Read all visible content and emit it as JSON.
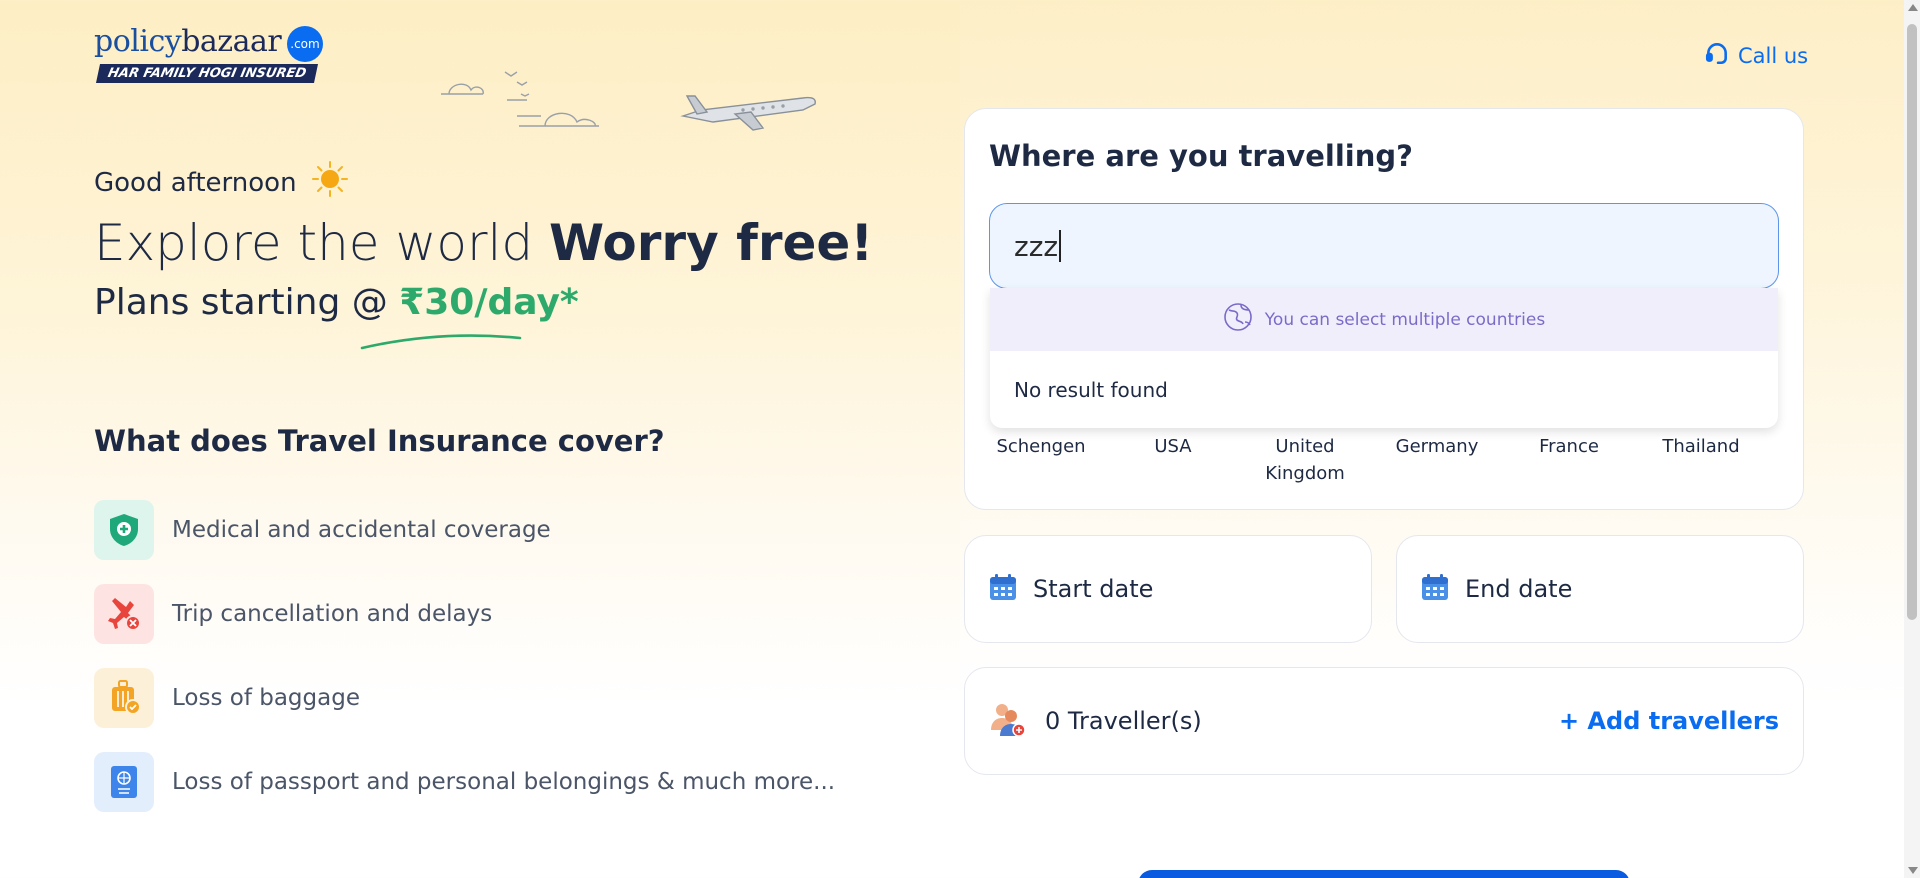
{
  "brand": {
    "logo_policy": "policy",
    "logo_bazaar": "bazaar",
    "logo_com": ".com",
    "tagline": "HAR FAMILY HOGI INSURED",
    "accent": "#0a6cf0"
  },
  "header": {
    "call_us": "Call us"
  },
  "hero": {
    "greeting": "Good afternoon",
    "headline_light": "Explore the world",
    "headline_bold": "Worry free!",
    "plans_prefix": "Plans starting @",
    "plans_price": "₹30/day*",
    "price_color": "#2daa6b"
  },
  "coverage": {
    "title": "What does Travel Insurance cover?",
    "items": [
      {
        "label": "Medical and accidental coverage",
        "icon": "medical-shield-icon"
      },
      {
        "label": "Trip cancellation and delays",
        "icon": "cancelled-flight-icon"
      },
      {
        "label": "Loss of baggage",
        "icon": "baggage-icon"
      },
      {
        "label": "Loss of passport and personal belongings & much more...",
        "icon": "passport-icon"
      }
    ]
  },
  "destination": {
    "title": "Where are you travelling?",
    "input_value": "zzz",
    "dropdown_hint": "You can select multiple countries",
    "no_result": "No result found",
    "countries": [
      "Schengen",
      "USA",
      "United Kingdom",
      "Germany",
      "France",
      "Thailand"
    ]
  },
  "dates": {
    "start": "Start date",
    "end": "End date"
  },
  "travellers": {
    "count": "0 Traveller(s)",
    "add": "+ Add travellers"
  }
}
